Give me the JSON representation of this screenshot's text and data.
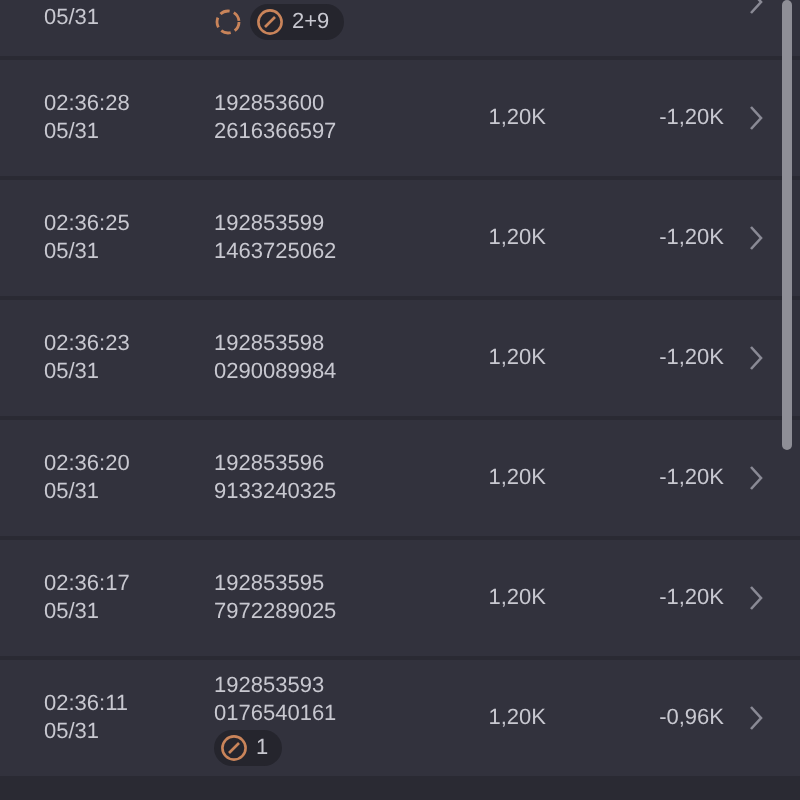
{
  "rows": [
    {
      "date": "05/31",
      "ids": [],
      "badges": {
        "pending": true,
        "count": "2+9"
      }
    },
    {
      "time": "02:36:28",
      "date": "05/31",
      "ids": [
        "192853600",
        "2616366597"
      ],
      "amount": "1,20K",
      "net": "-1,20K"
    },
    {
      "time": "02:36:25",
      "date": "05/31",
      "ids": [
        "192853599",
        "1463725062"
      ],
      "amount": "1,20K",
      "net": "-1,20K"
    },
    {
      "time": "02:36:23",
      "date": "05/31",
      "ids": [
        "192853598",
        "0290089984"
      ],
      "amount": "1,20K",
      "net": "-1,20K"
    },
    {
      "time": "02:36:20",
      "date": "05/31",
      "ids": [
        "192853596",
        "9133240325"
      ],
      "amount": "1,20K",
      "net": "-1,20K"
    },
    {
      "time": "02:36:17",
      "date": "05/31",
      "ids": [
        "192853595",
        "7972289025"
      ],
      "amount": "1,20K",
      "net": "-1,20K"
    },
    {
      "time": "02:36:11",
      "date": "05/31",
      "ids": [
        "192853593",
        "0176540161"
      ],
      "amount": "1,20K",
      "net": "-0,96K",
      "badges": {
        "pending": false,
        "count": "1"
      }
    }
  ]
}
